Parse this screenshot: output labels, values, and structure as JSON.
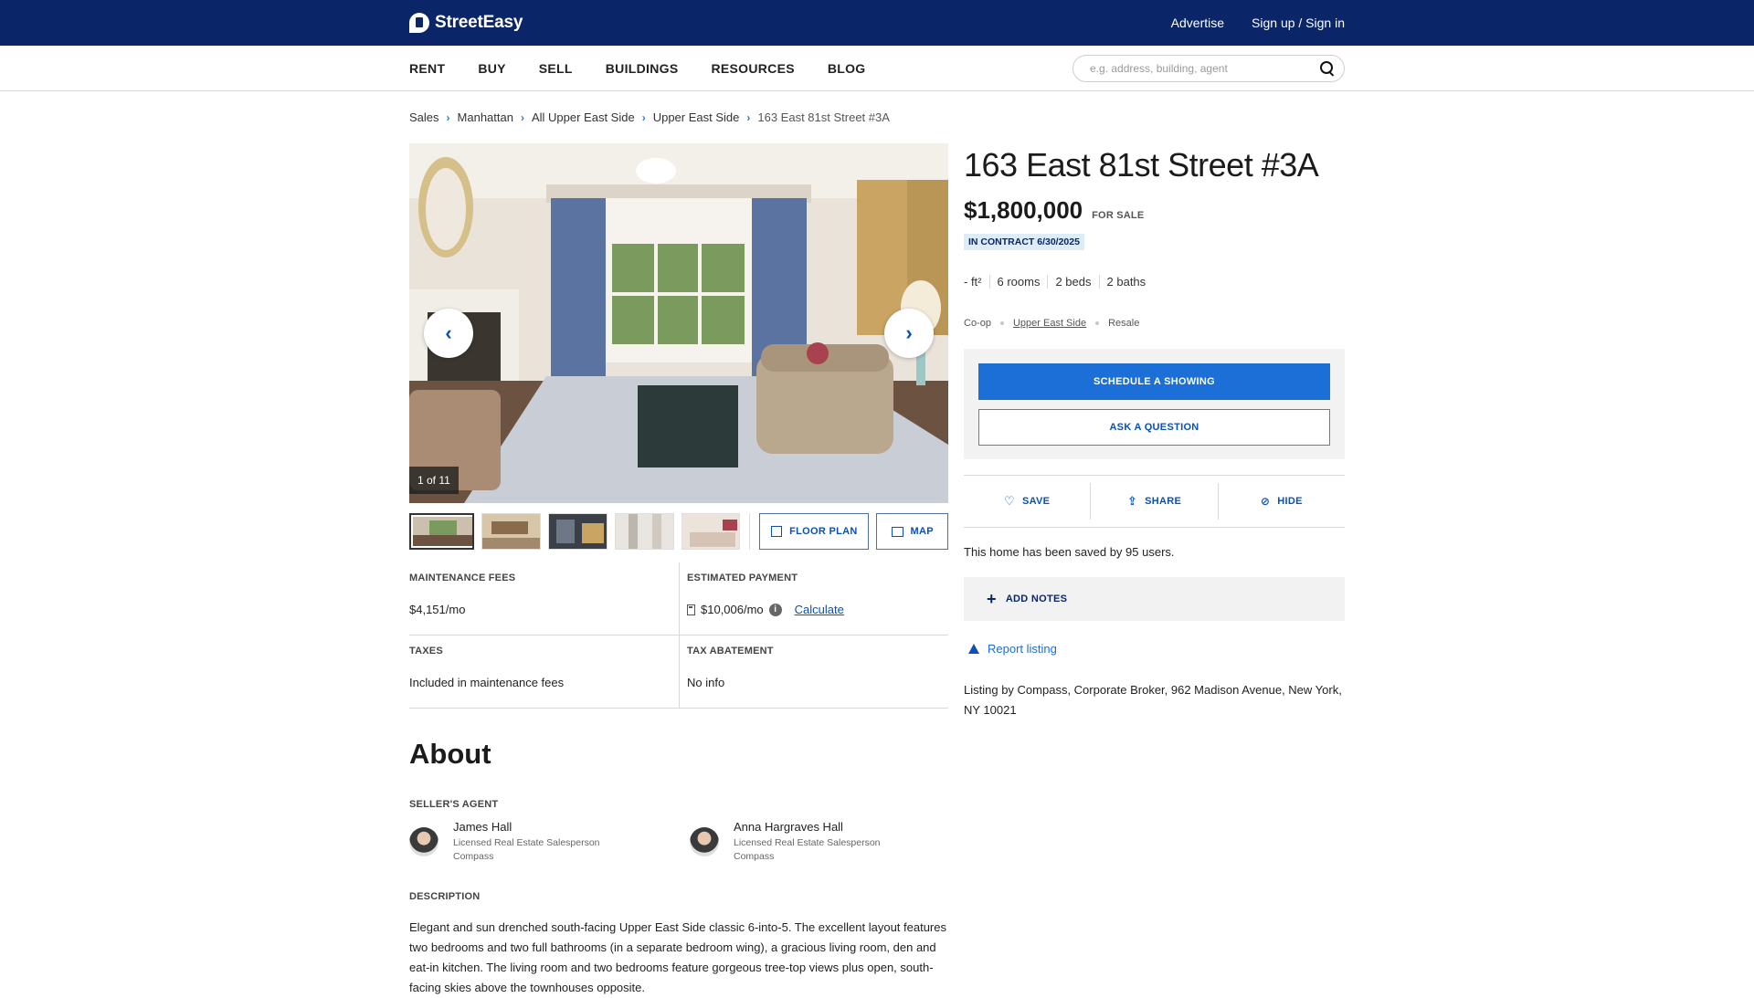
{
  "header": {
    "brand": "StreetEasy",
    "links": [
      "Advertise",
      "Sign up / Sign in"
    ]
  },
  "nav": {
    "items": [
      "RENT",
      "BUY",
      "SELL",
      "BUILDINGS",
      "RESOURCES",
      "BLOG"
    ],
    "search_placeholder": "e.g. address, building, agent"
  },
  "breadcrumb": [
    "Sales",
    "Manhattan",
    "All Upper East Side",
    "Upper East Side",
    "163 East 81st Street #3A"
  ],
  "gallery": {
    "counter": "1 of 11",
    "floor_plan_label": "FLOOR PLAN",
    "map_label": "MAP"
  },
  "facts": {
    "maintenance_label": "MAINTENANCE FEES",
    "maintenance_value": "$4,151/mo",
    "payment_label": "ESTIMATED PAYMENT",
    "payment_value": "$10,006/mo",
    "payment_info": "i",
    "calculate_label": "Calculate",
    "taxes_label": "TAXES",
    "taxes_value": "Included in maintenance fees",
    "abatement_label": "TAX ABATEMENT",
    "abatement_value": "No info"
  },
  "about": {
    "title": "About",
    "agent_section": "SELLER'S AGENT",
    "agents": [
      {
        "name": "James Hall",
        "role": "Licensed Real Estate Salesperson",
        "company": "Compass"
      },
      {
        "name": "Anna Hargraves Hall",
        "role": "Licensed Real Estate Salesperson",
        "company": "Compass"
      }
    ],
    "description_label": "DESCRIPTION",
    "description": "Elegant and sun drenched south-facing Upper East Side classic 6-into-5. The excellent layout features two bedrooms and two full bathrooms (in a separate bedroom wing), a gracious living room, den and eat-in kitchen. The living room and two bedrooms feature gorgeous tree-top views plus open, south-facing skies above the townhouses opposite."
  },
  "listing": {
    "address": "163 East 81st Street #3A",
    "price": "$1,800,000",
    "status": "FOR SALE",
    "contract": "IN CONTRACT 6/30/2025",
    "sqft": "- ft²",
    "rooms": "6 rooms",
    "beds": "2 beds",
    "baths": "2 baths",
    "type": "Co-op",
    "neighborhood": "Upper East Side",
    "sale_type": "Resale"
  },
  "cta": {
    "schedule": "SCHEDULE A SHOWING",
    "ask": "ASK A QUESTION"
  },
  "actions": {
    "save": "SAVE",
    "share": "SHARE",
    "hide": "HIDE"
  },
  "saved_text": "This home has been saved by 95 users.",
  "notes_label": "ADD NOTES",
  "report_label": "Report listing",
  "broker": "Listing by Compass, Corporate Broker, 962 Madison Avenue, New York, NY 10021",
  "colors": {
    "header_bg": "#0b2668",
    "accent_blue": "#1b6fd6",
    "link_blue": "#0b50b5",
    "contract_bg": "#dcecf8"
  }
}
